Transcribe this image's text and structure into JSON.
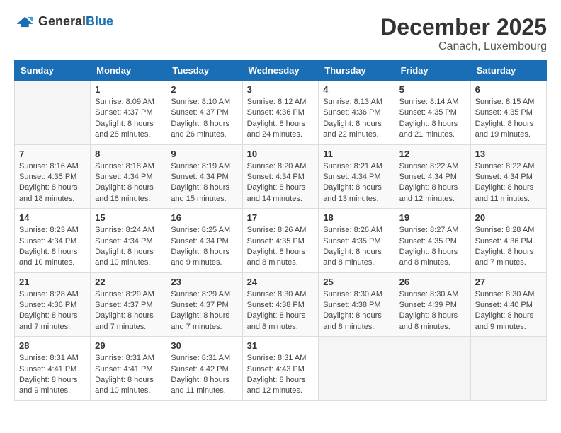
{
  "header": {
    "logo_general": "General",
    "logo_blue": "Blue",
    "month_title": "December 2025",
    "location": "Canach, Luxembourg"
  },
  "calendar": {
    "days_of_week": [
      "Sunday",
      "Monday",
      "Tuesday",
      "Wednesday",
      "Thursday",
      "Friday",
      "Saturday"
    ],
    "weeks": [
      [
        {
          "day": "",
          "info": ""
        },
        {
          "day": "1",
          "info": "Sunrise: 8:09 AM\nSunset: 4:37 PM\nDaylight: 8 hours\nand 28 minutes."
        },
        {
          "day": "2",
          "info": "Sunrise: 8:10 AM\nSunset: 4:37 PM\nDaylight: 8 hours\nand 26 minutes."
        },
        {
          "day": "3",
          "info": "Sunrise: 8:12 AM\nSunset: 4:36 PM\nDaylight: 8 hours\nand 24 minutes."
        },
        {
          "day": "4",
          "info": "Sunrise: 8:13 AM\nSunset: 4:36 PM\nDaylight: 8 hours\nand 22 minutes."
        },
        {
          "day": "5",
          "info": "Sunrise: 8:14 AM\nSunset: 4:35 PM\nDaylight: 8 hours\nand 21 minutes."
        },
        {
          "day": "6",
          "info": "Sunrise: 8:15 AM\nSunset: 4:35 PM\nDaylight: 8 hours\nand 19 minutes."
        }
      ],
      [
        {
          "day": "7",
          "info": "Sunrise: 8:16 AM\nSunset: 4:35 PM\nDaylight: 8 hours\nand 18 minutes."
        },
        {
          "day": "8",
          "info": "Sunrise: 8:18 AM\nSunset: 4:34 PM\nDaylight: 8 hours\nand 16 minutes."
        },
        {
          "day": "9",
          "info": "Sunrise: 8:19 AM\nSunset: 4:34 PM\nDaylight: 8 hours\nand 15 minutes."
        },
        {
          "day": "10",
          "info": "Sunrise: 8:20 AM\nSunset: 4:34 PM\nDaylight: 8 hours\nand 14 minutes."
        },
        {
          "day": "11",
          "info": "Sunrise: 8:21 AM\nSunset: 4:34 PM\nDaylight: 8 hours\nand 13 minutes."
        },
        {
          "day": "12",
          "info": "Sunrise: 8:22 AM\nSunset: 4:34 PM\nDaylight: 8 hours\nand 12 minutes."
        },
        {
          "day": "13",
          "info": "Sunrise: 8:22 AM\nSunset: 4:34 PM\nDaylight: 8 hours\nand 11 minutes."
        }
      ],
      [
        {
          "day": "14",
          "info": "Sunrise: 8:23 AM\nSunset: 4:34 PM\nDaylight: 8 hours\nand 10 minutes."
        },
        {
          "day": "15",
          "info": "Sunrise: 8:24 AM\nSunset: 4:34 PM\nDaylight: 8 hours\nand 10 minutes."
        },
        {
          "day": "16",
          "info": "Sunrise: 8:25 AM\nSunset: 4:34 PM\nDaylight: 8 hours\nand 9 minutes."
        },
        {
          "day": "17",
          "info": "Sunrise: 8:26 AM\nSunset: 4:35 PM\nDaylight: 8 hours\nand 8 minutes."
        },
        {
          "day": "18",
          "info": "Sunrise: 8:26 AM\nSunset: 4:35 PM\nDaylight: 8 hours\nand 8 minutes."
        },
        {
          "day": "19",
          "info": "Sunrise: 8:27 AM\nSunset: 4:35 PM\nDaylight: 8 hours\nand 8 minutes."
        },
        {
          "day": "20",
          "info": "Sunrise: 8:28 AM\nSunset: 4:36 PM\nDaylight: 8 hours\nand 7 minutes."
        }
      ],
      [
        {
          "day": "21",
          "info": "Sunrise: 8:28 AM\nSunset: 4:36 PM\nDaylight: 8 hours\nand 7 minutes."
        },
        {
          "day": "22",
          "info": "Sunrise: 8:29 AM\nSunset: 4:37 PM\nDaylight: 8 hours\nand 7 minutes."
        },
        {
          "day": "23",
          "info": "Sunrise: 8:29 AM\nSunset: 4:37 PM\nDaylight: 8 hours\nand 7 minutes."
        },
        {
          "day": "24",
          "info": "Sunrise: 8:30 AM\nSunset: 4:38 PM\nDaylight: 8 hours\nand 8 minutes."
        },
        {
          "day": "25",
          "info": "Sunrise: 8:30 AM\nSunset: 4:38 PM\nDaylight: 8 hours\nand 8 minutes."
        },
        {
          "day": "26",
          "info": "Sunrise: 8:30 AM\nSunset: 4:39 PM\nDaylight: 8 hours\nand 8 minutes."
        },
        {
          "day": "27",
          "info": "Sunrise: 8:30 AM\nSunset: 4:40 PM\nDaylight: 8 hours\nand 9 minutes."
        }
      ],
      [
        {
          "day": "28",
          "info": "Sunrise: 8:31 AM\nSunset: 4:41 PM\nDaylight: 8 hours\nand 9 minutes."
        },
        {
          "day": "29",
          "info": "Sunrise: 8:31 AM\nSunset: 4:41 PM\nDaylight: 8 hours\nand 10 minutes."
        },
        {
          "day": "30",
          "info": "Sunrise: 8:31 AM\nSunset: 4:42 PM\nDaylight: 8 hours\nand 11 minutes."
        },
        {
          "day": "31",
          "info": "Sunrise: 8:31 AM\nSunset: 4:43 PM\nDaylight: 8 hours\nand 12 minutes."
        },
        {
          "day": "",
          "info": ""
        },
        {
          "day": "",
          "info": ""
        },
        {
          "day": "",
          "info": ""
        }
      ]
    ]
  }
}
